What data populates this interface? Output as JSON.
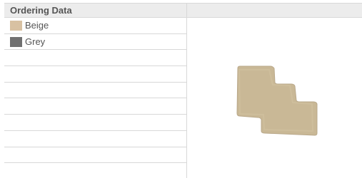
{
  "table": {
    "header": "Ordering Data",
    "rows": [
      {
        "label": "Beige",
        "color": "#d8c1a2"
      },
      {
        "label": "Grey",
        "color": "#707070"
      },
      {
        "label": ""
      },
      {
        "label": ""
      },
      {
        "label": ""
      },
      {
        "label": ""
      },
      {
        "label": ""
      },
      {
        "label": ""
      },
      {
        "label": ""
      },
      {
        "label": ""
      }
    ]
  },
  "image": {
    "icon": "terminal-block-icon",
    "fill": "#c9b896"
  }
}
